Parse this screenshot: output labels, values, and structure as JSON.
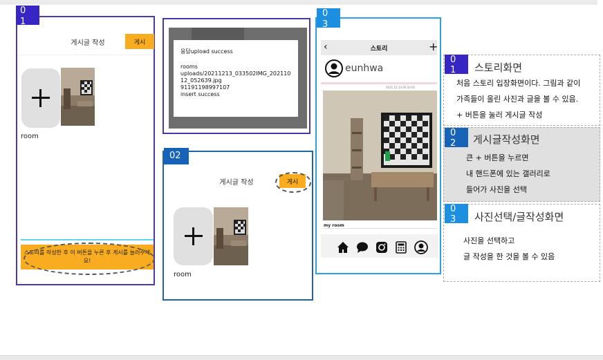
{
  "colors": {
    "frame_purple": "#4a3aa8",
    "frame_blue": "#1f64a8",
    "frame_lightblue": "#2b9fe0",
    "badge_purple": "#3826c4",
    "badge_blue": "#1763b8",
    "badge_lightblue": "#1d8fe0",
    "accent_orange": "#f9ac1f",
    "tile_grey": "#e0e0e0"
  },
  "screen1": {
    "badge": "0\n1",
    "header_title": "게시글 작성",
    "post_button": "게시",
    "add_icon": "plus-icon",
    "thumb_label": "room",
    "bottom_button": "스토리를 작성한 후 이 버튼을 누른 후 게시를 눌러주세요!"
  },
  "dialog": {
    "title": "응답upload success",
    "lines": [
      "rooms",
      "uploads/20211213_033502IMG_202110",
      "12_052639.jpg",
      "91191198997107",
      "insert success"
    ]
  },
  "screen2": {
    "badge": "02",
    "header_title": "게시글 작성",
    "post_button": "게시",
    "add_icon": "plus-icon",
    "thumb_label": "room"
  },
  "screen3": {
    "badge": "0\n3",
    "header_title": "스토리",
    "back_icon": "chevron-left-icon",
    "add_icon": "plus-icon",
    "user_avatar_icon": "user-avatar-icon",
    "username": "eunhwa",
    "post_date": "2021.12.13 05:33:02",
    "caption": "my room",
    "nav_icons": [
      "home-icon",
      "chat-icon",
      "instagram-icon",
      "calculator-icon",
      "profile-icon"
    ]
  },
  "descriptions": [
    {
      "badge": "0\n1",
      "title": "스토리화면",
      "lines": [
        "처음 스토리 입장화면이다. 그림과 같이",
        "가족들이 올린 사진과 글을 볼 수 있음.",
        "+ 버튼을 눌러 게시글 작성"
      ]
    },
    {
      "badge": "0\n2",
      "title": "게시글작성화면",
      "lines": [
        "큰 + 버튼을 누르면",
        "내 핸드폰에 있는 갤러리로",
        "들어가 사진을 선택"
      ]
    },
    {
      "badge": "0\n3",
      "title": "사진선택/글작성화면",
      "lines": [
        "사진을 선택하고",
        "글 작성을 한 것을 볼 수 있음"
      ]
    }
  ]
}
